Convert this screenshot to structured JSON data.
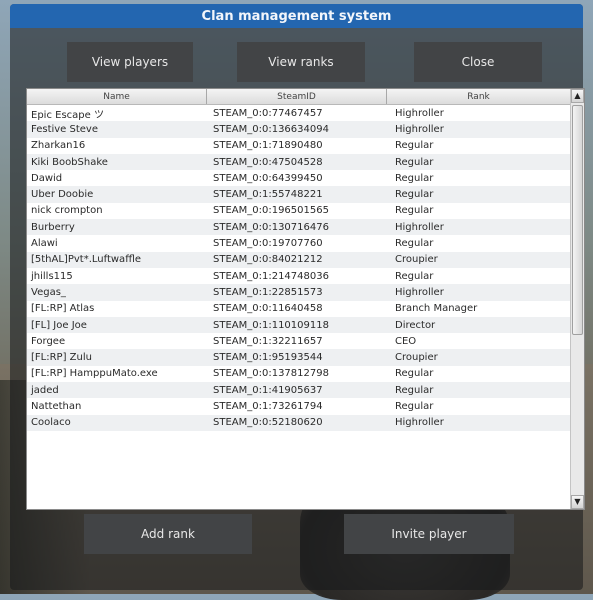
{
  "window": {
    "title": "Clan management system"
  },
  "toolbar": {
    "view_players": "View players",
    "view_ranks": "View ranks",
    "close": "Close"
  },
  "table": {
    "columns": [
      "Name",
      "SteamID",
      "Rank"
    ],
    "rows": [
      [
        "Epic Escape ツ",
        "STEAM_0:0:77467457",
        "Highroller"
      ],
      [
        "Festive Steve",
        "STEAM_0:0:136634094",
        "Highroller"
      ],
      [
        "Zharkan16",
        "STEAM_0:1:71890480",
        "Regular"
      ],
      [
        "Kiki BoobShake",
        "STEAM_0:0:47504528",
        "Regular"
      ],
      [
        "Dawid",
        "STEAM_0:0:64399450",
        "Regular"
      ],
      [
        "Uber Doobie",
        "STEAM_0:1:55748221",
        "Regular"
      ],
      [
        "nick crompton",
        "STEAM_0:0:196501565",
        "Regular"
      ],
      [
        "Burberry",
        "STEAM_0:0:130716476",
        "Highroller"
      ],
      [
        "Alawi",
        "STEAM_0:0:19707760",
        "Regular"
      ],
      [
        "[5thAL]Pvt*.Luftwaffle",
        "STEAM_0:0:84021212",
        "Croupier"
      ],
      [
        "jhills115",
        "STEAM_0:1:214748036",
        "Regular"
      ],
      [
        "Vegas_",
        "STEAM_0:1:22851573",
        "Highroller"
      ],
      [
        "[FL:RP] Atlas",
        "STEAM_0:0:11640458",
        "Branch Manager"
      ],
      [
        "[FL] Joe Joe",
        "STEAM_0:1:110109118",
        "Director"
      ],
      [
        "Forgee",
        "STEAM_0:1:32211657",
        "CEO"
      ],
      [
        "[FL:RP] Zulu",
        "STEAM_0:1:95193544",
        "Croupier"
      ],
      [
        "[FL:RP] HamppuMato.exe",
        "STEAM_0:0:137812798",
        "Regular"
      ],
      [
        "jaded",
        "STEAM_0:1:41905637",
        "Regular"
      ],
      [
        "Nattethan",
        "STEAM_0:1:73261794",
        "Regular"
      ],
      [
        "Coolaco",
        "STEAM_0:0:52180620",
        "Highroller"
      ]
    ]
  },
  "footer": {
    "add_rank": "Add rank",
    "invite_player": "Invite player"
  },
  "icons": {
    "scroll_up": "arrow-up-icon",
    "scroll_down": "arrow-down-icon"
  },
  "colors": {
    "titlebar": "#2366b0",
    "button": "#424446"
  }
}
